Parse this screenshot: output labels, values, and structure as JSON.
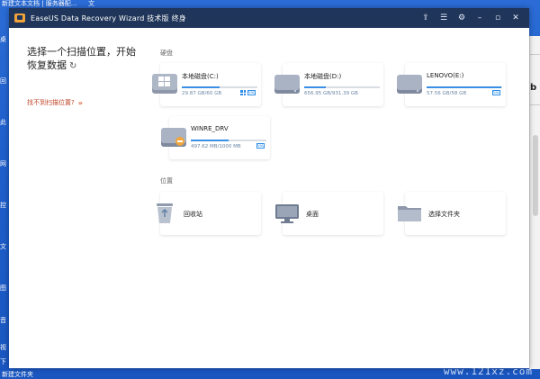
{
  "desktop": {
    "top_left_text": "新建文本文档 | 服务器配...",
    "top_mid_text": "文",
    "left_glyphs": [
      "桌",
      "回",
      "此",
      "网",
      "控",
      "文",
      "图",
      "音",
      "视",
      "下"
    ],
    "bottom_text": "新建文件夹",
    "watermark": "www.121xz.com"
  },
  "browser_fragment": {
    "text": "b"
  },
  "window": {
    "title": "EaseUS Data Recovery Wizard 技术版 终身",
    "titlebar_icons": [
      "upgrade-icon",
      "menu-icon",
      "settings-icon",
      "minimize-icon",
      "maximize-icon",
      "close-icon"
    ],
    "titlebar_glyphs": [
      "⇪",
      "☰",
      "⚙",
      "–",
      "▫",
      "✕"
    ],
    "heading": "选择一个扫描位置，开始恢复数据",
    "refresh_glyph": "↻",
    "link_text": "找不到扫描位置?",
    "link_arrows": "»"
  },
  "sections": {
    "drives_label": "硬盘",
    "locations_label": "位置"
  },
  "drives": [
    {
      "name": "本地磁盘(C:)",
      "size": "29.87 GB/60 GB",
      "used_fraction": 0.5,
      "system": true,
      "ssd": true
    },
    {
      "name": "本地磁盘(D:)",
      "size": "656.95 GB/931.39 GB",
      "used_fraction": 0.29,
      "system": false,
      "ssd": false
    },
    {
      "name": "LENOVO(E:)",
      "size": "57.56 GB/58 GB",
      "used_fraction": 0.99,
      "system": false,
      "ssd": true
    },
    {
      "name": "WINRE_DRV",
      "size": "497.62 MB/1000 MB",
      "used_fraction": 0.5,
      "system": false,
      "ssd": true
    }
  ],
  "badge_ssd_text": "SSD",
  "locations": [
    {
      "name": "回收站",
      "icon": "recycle-bin-icon"
    },
    {
      "name": "桌面",
      "icon": "desktop-monitor-icon"
    },
    {
      "name": "选择文件夹",
      "icon": "folder-icon"
    }
  ],
  "colors": {
    "titlebar": "#1f3559",
    "accent": "#3a8ee6",
    "link": "#c0472a",
    "desktop_bg": "#1f5fcc"
  }
}
